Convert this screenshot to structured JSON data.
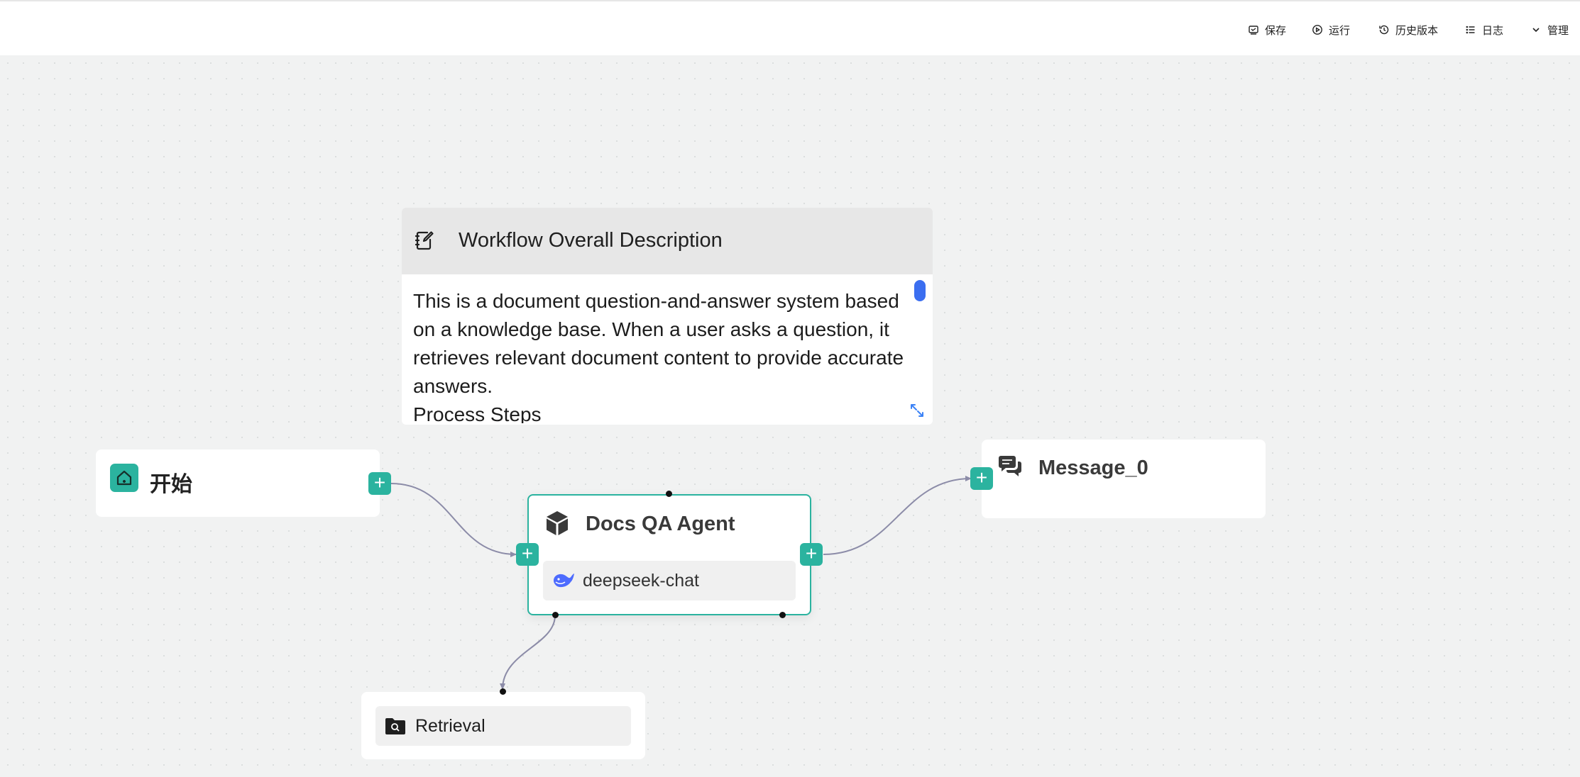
{
  "toolbar": {
    "save": "保存",
    "run": "运行",
    "history": "历史版本",
    "logs": "日志",
    "manage": "管理"
  },
  "note": {
    "title": "Workflow Overall Description",
    "body": "This is a document question-and-answer system based on a knowledge base. When a user asks a question, it retrieves relevant document content to provide accurate answers.\nProcess Steps"
  },
  "nodes": {
    "start": {
      "label": "开始",
      "icon": "home-icon"
    },
    "agent": {
      "label": "Docs QA Agent",
      "icon": "cube-icon",
      "model": "deepseek-chat",
      "model_icon": "whale-icon"
    },
    "message": {
      "label": "Message_0",
      "icon": "chat-bubbles-icon"
    },
    "retrieval": {
      "label": "Retrieval",
      "icon": "folder-search-icon"
    }
  },
  "colors": {
    "accent": "#2bb39f",
    "edge": "#8c8ca8",
    "scrollbar": "#3b6ef0"
  }
}
